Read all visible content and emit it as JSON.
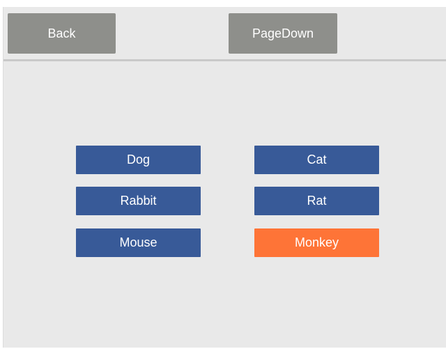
{
  "toolbar": {
    "back_label": "Back",
    "pagedown_label": "PageDown"
  },
  "animals": [
    {
      "label": "Dog",
      "selected": false
    },
    {
      "label": "Cat",
      "selected": false
    },
    {
      "label": "Rabbit",
      "selected": false
    },
    {
      "label": "Rat",
      "selected": false
    },
    {
      "label": "Mouse",
      "selected": false
    },
    {
      "label": "Monkey",
      "selected": true
    }
  ],
  "colors": {
    "background": "#e9e9e9",
    "nav_button": "#8e8f8b",
    "option_button": "#385a98",
    "selected_button": "#fe7437",
    "text": "#ffffff"
  }
}
